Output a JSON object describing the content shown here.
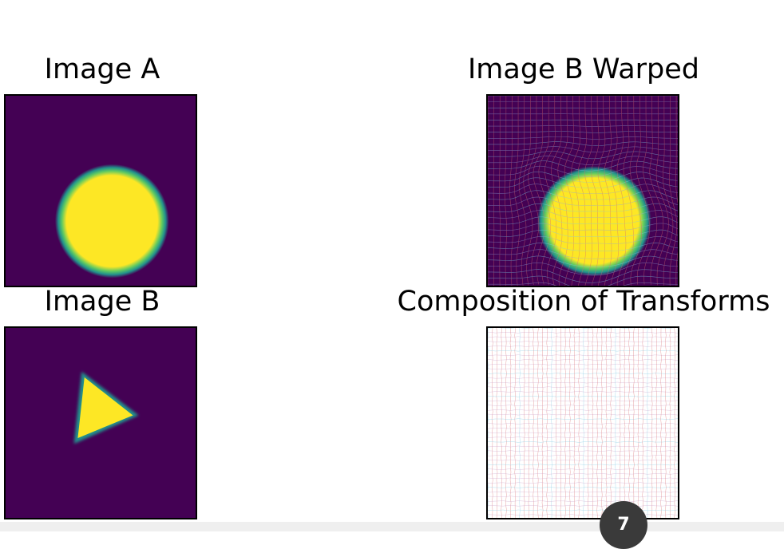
{
  "panels": {
    "image_a": {
      "title": "Image A"
    },
    "image_b_warped": {
      "title": "Image B Warped"
    },
    "image_b": {
      "title": "Image B"
    },
    "composition": {
      "title": "Composition of Transforms"
    }
  },
  "page_badge": {
    "number": "7"
  },
  "colors": {
    "background_purple": "#440154",
    "shape_yellow": "#fde725",
    "edge_teal": "#21918c",
    "edge_green": "#5ec962",
    "grid_line_red": "#d86a6a",
    "grid_line_blue": "#7ec8e3"
  }
}
